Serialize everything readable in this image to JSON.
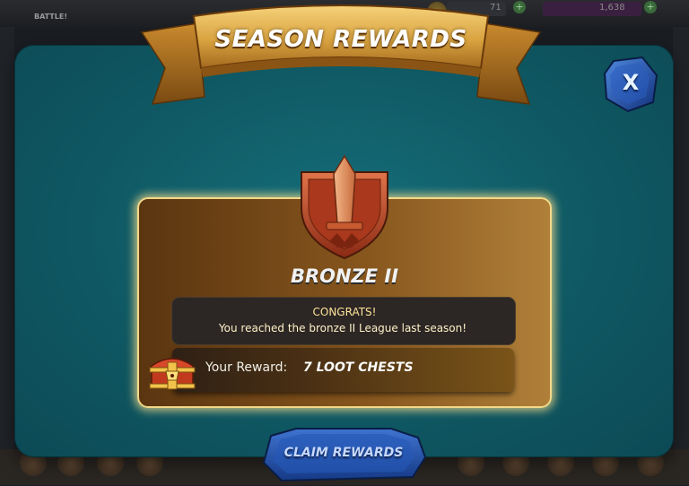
{
  "background": {
    "battle_label": "BATTLE!",
    "currency_1": "71",
    "currency_2": "1,638",
    "plus_icon": "+"
  },
  "modal": {
    "title": "SEASON REWARDS",
    "close_label": "X",
    "league": "BRONZE II",
    "congrats_title": "CONGRATS!",
    "congrats_message": "You reached the bronze II League last season!",
    "reward_label": "Your Reward:",
    "reward_value": "7 LOOT CHESTS",
    "claim_label": "CLAIM REWARDS"
  },
  "icons": {
    "medal": "bronze-league-medal-icon",
    "chest": "loot-chest-icon",
    "close": "close-icon"
  },
  "colors": {
    "panel": "#0f5863",
    "card_border": "#f2d98a",
    "card_fill": "#87561d",
    "banner_gold": "#d9a340",
    "medal_bronze": "#c0502a",
    "claim_blue": "#1f52a8"
  }
}
